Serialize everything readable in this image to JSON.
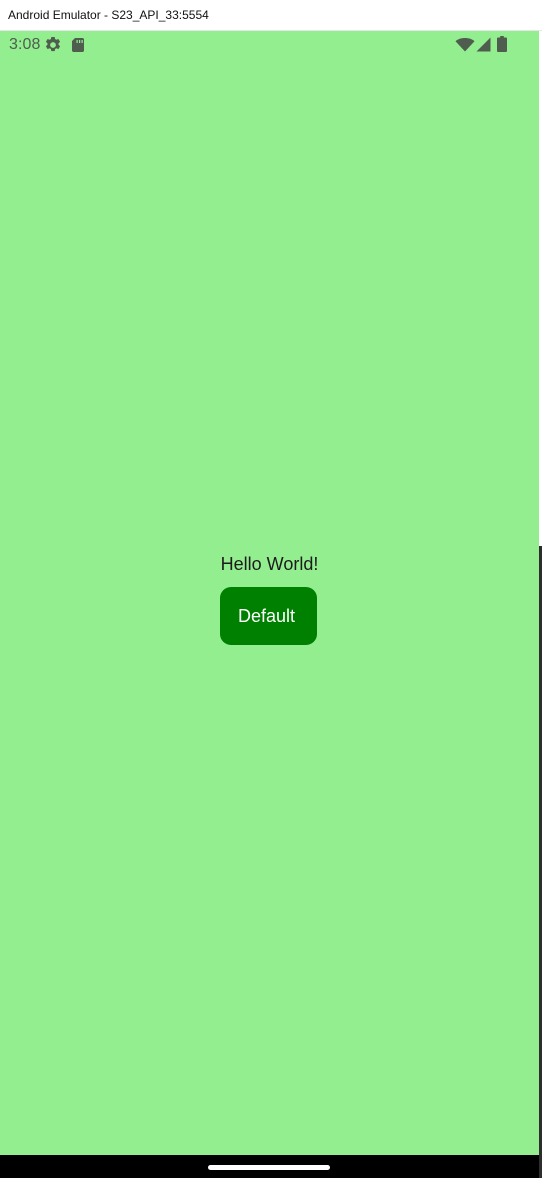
{
  "window": {
    "title": "Android Emulator - S23_API_33:5554"
  },
  "status_bar": {
    "time": "3:08",
    "left_icons": [
      "settings-gear-icon",
      "sd-card-icon"
    ],
    "right_icons": [
      "wifi-icon",
      "cellular-signal-icon",
      "battery-icon"
    ]
  },
  "main": {
    "hello_text": "Hello World!",
    "button_label": "Default"
  },
  "colors": {
    "screen_background": "#93ee90",
    "button_background": "#008000",
    "button_text": "#ffffff",
    "status_icons": "#4f5d4f",
    "navigation_bar": "#000000",
    "home_handle": "#ffffff"
  }
}
